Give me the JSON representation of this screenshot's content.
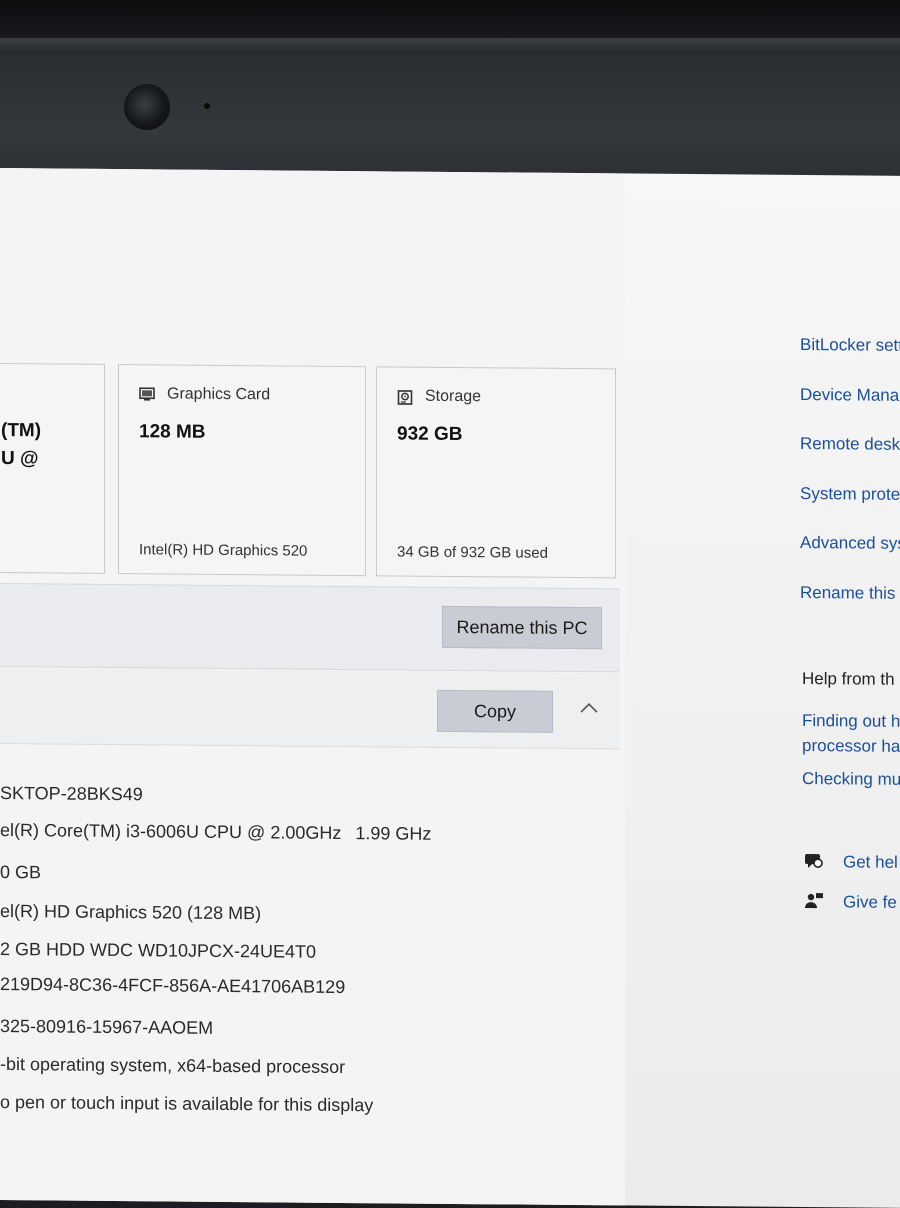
{
  "cards": [
    {
      "id": "processor",
      "value_line1": "(TM)",
      "value_line2": "U @"
    },
    {
      "id": "graphics",
      "icon": "monitor-icon",
      "label": "Graphics Card",
      "value": "128 MB",
      "detail": "Intel(R) HD Graphics 520"
    },
    {
      "id": "storage",
      "icon": "drive-icon",
      "label": "Storage",
      "value": "932 GB",
      "detail": "34 GB of 932 GB used"
    }
  ],
  "rename_button_label": "Rename this PC",
  "copy_button_label": "Copy",
  "specs": [
    {
      "value": "SKTOP-28BKS49"
    },
    {
      "value": "el(R) Core(TM) i3-6006U CPU @ 2.00GHz",
      "extra": "1.99 GHz"
    },
    {
      "value": "0 GB"
    },
    {
      "value": "el(R) HD Graphics 520 (128 MB)"
    },
    {
      "value": "2 GB HDD WDC WD10JPCX-24UE4T0"
    },
    {
      "value": "219D94-8C36-4FCF-856A-AE41706AB129"
    },
    {
      "value": "325-80916-15967-AAOEM"
    },
    {
      "value": "-bit operating system, x64-based processor"
    },
    {
      "value": "o pen or touch input is available for this display"
    }
  ],
  "related_settings": [
    "BitLocker sett",
    "Device Mana",
    "Remote desk",
    "System prote",
    "Advanced sys",
    "Rename this"
  ],
  "help": {
    "heading": "Help from th",
    "links": [
      "Finding out h",
      "processor ha",
      "Checking mu"
    ]
  },
  "footer_links": [
    {
      "icon": "help-chat-icon",
      "label": "Get hel"
    },
    {
      "icon": "feedback-icon",
      "label": "Give fe"
    }
  ],
  "colors": {
    "link": "#1a4f9c",
    "button": "#c9ccd4",
    "card_border": "#c9c9c9"
  }
}
